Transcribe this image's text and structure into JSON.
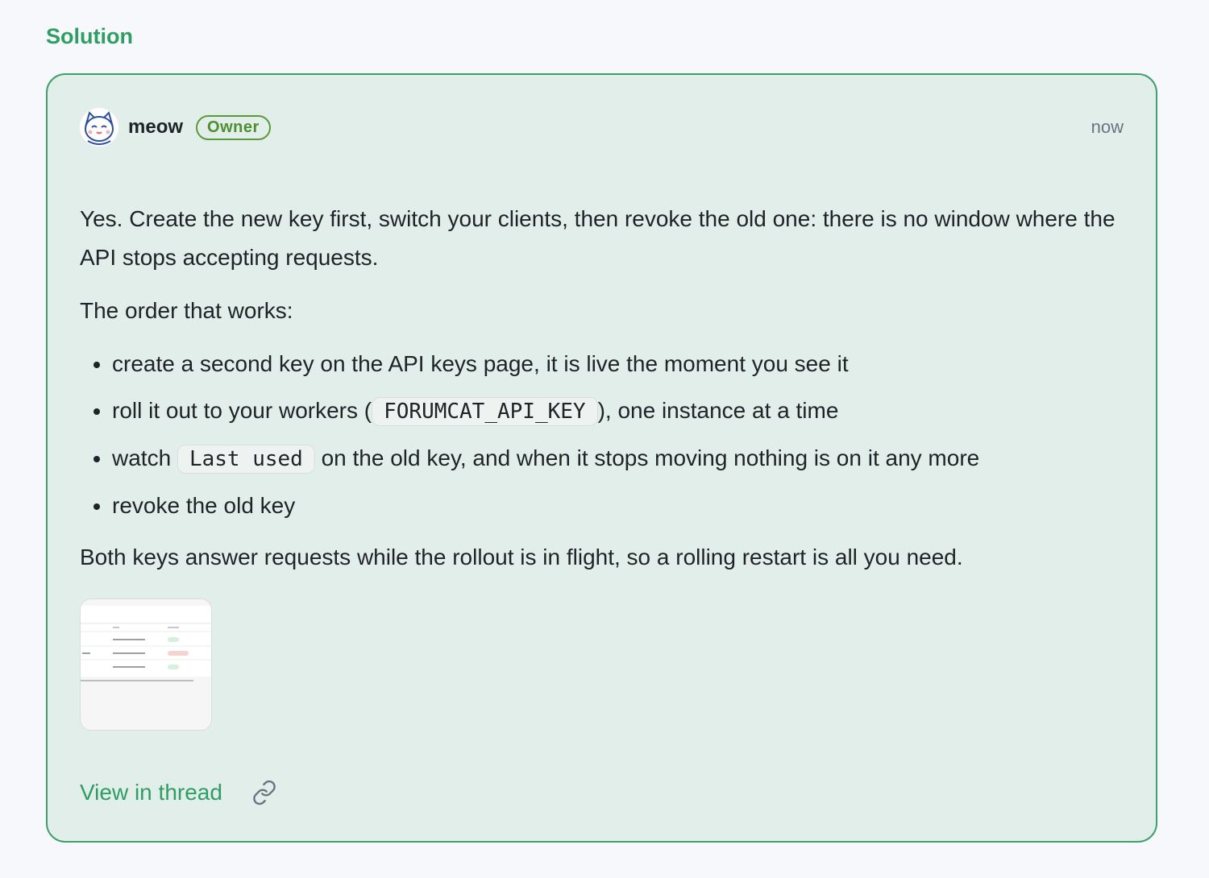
{
  "section": {
    "title": "Solution"
  },
  "post": {
    "author": "meow",
    "role_badge": "Owner",
    "timestamp": "now",
    "paragraph_1": "Yes. Create the new key first, switch your clients, then revoke the old one: there is no window where the API stops accepting requests.",
    "paragraph_2": "The order that works:",
    "list": [
      {
        "text": "create a second key on the API keys page, it is live the moment you see it"
      },
      {
        "before": "roll it out to your workers (",
        "code": "FORUMCAT_API_KEY",
        "after": "), one instance at a time"
      },
      {
        "before": "watch ",
        "code": "Last used",
        "after": " on the old key, and when it stops moving nothing is on it any more"
      },
      {
        "text": "revoke the old key"
      }
    ],
    "paragraph_3": "Both keys answer requests while the rollout is in flight, so a rolling restart is all you need."
  },
  "footer": {
    "view_link": "View in thread",
    "copy_link_icon": "link-icon"
  },
  "colors": {
    "accent": "#2f9e63",
    "card_bg": "#e2eeea",
    "badge": "#4f8f2f"
  }
}
